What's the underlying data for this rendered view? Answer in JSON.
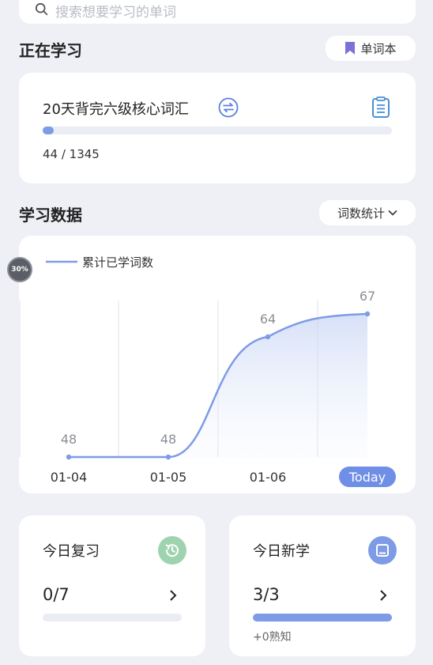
{
  "search": {
    "placeholder": "搜索想要学习的单词"
  },
  "studying": {
    "section_title": "正在学习",
    "wordbook_label": "单词本",
    "book_title": "20天背完六级核心词汇",
    "progress_text": "44 / 1345",
    "progress_fraction": 0.0327
  },
  "stats": {
    "section_title": "学习数据",
    "dropdown_label": "词数统计",
    "badge_percent": "30%"
  },
  "chart_data": {
    "type": "line",
    "series": [
      {
        "name": "累计已学词数",
        "values": [
          48,
          48,
          64,
          67
        ]
      }
    ],
    "categories": [
      "01-04",
      "01-05",
      "01-06",
      "Today"
    ],
    "data_labels": [
      "48",
      "48",
      "64",
      "67"
    ],
    "highlight_category": "Today",
    "colors": {
      "line": "#7e9be6",
      "today_pill": "#6f8fe6"
    }
  },
  "review": {
    "title": "今日复习",
    "progress_text": "0/7",
    "progress_fraction": 0
  },
  "new_words": {
    "title": "今日新学",
    "progress_text": "3/3",
    "progress_fraction": 1,
    "known_text": "+0熟知"
  },
  "colors": {
    "accent": "#7e9be6",
    "review_icon_bg": "#9fd3b0",
    "book_icon_bg": "#7e9be6",
    "wordbook_icon": "#7b72d6"
  }
}
